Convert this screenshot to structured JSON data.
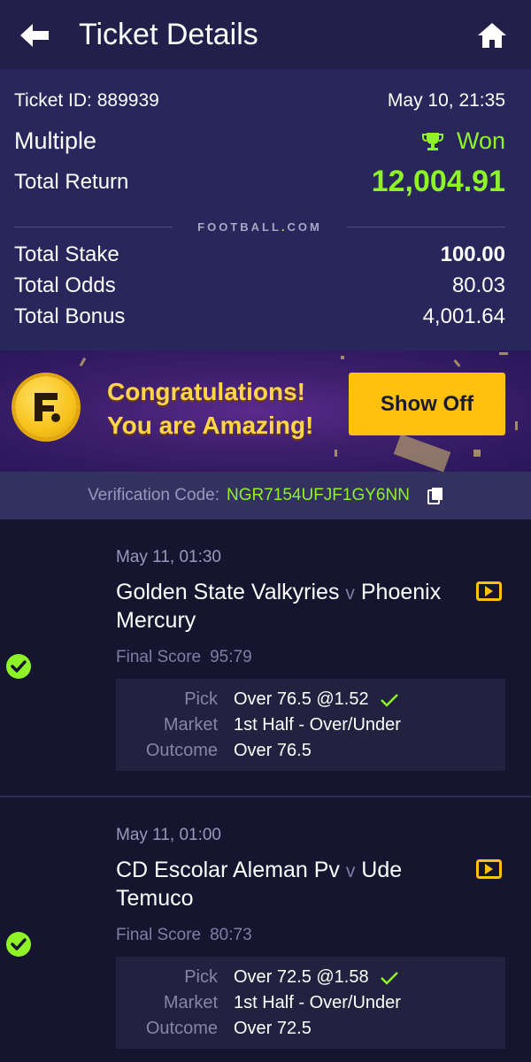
{
  "header": {
    "title": "Ticket Details",
    "back_icon": "arrow-left-icon",
    "home_icon": "home-icon"
  },
  "ticket": {
    "id_text": "Ticket ID: 889939",
    "datetime": "May 10, 21:35",
    "type": "Multiple",
    "status": "Won",
    "total_return_label": "Total Return",
    "total_return": "12,004.91",
    "brand": "FOOTBALL.COM",
    "stake_label": "Total Stake",
    "stake": "100.00",
    "odds_label": "Total Odds",
    "odds": "80.03",
    "bonus_label": "Total Bonus",
    "bonus": "4,001.64"
  },
  "banner": {
    "line1": "Congratulations!",
    "line2": "You are Amazing!",
    "button": "Show Off"
  },
  "verification": {
    "label": "Verification Code:",
    "code": "NGR7154UFJF1GY6NN"
  },
  "bets": [
    {
      "date": "May 11, 01:30",
      "home": "Golden State Valkyries",
      "vs": "v",
      "away": "Phoenix Mercury",
      "final_label": "Final Score",
      "score": "95:79",
      "pick_label": "Pick",
      "pick": "Over 76.5 @1.52",
      "market_label": "Market",
      "market": "1st Half - Over/Under",
      "outcome_label": "Outcome",
      "outcome": "Over 76.5"
    },
    {
      "date": "May 11, 01:00",
      "home": "CD Escolar Aleman Pv",
      "vs": "v",
      "away": "Ude Temuco",
      "final_label": "Final Score",
      "score": "80:73",
      "pick_label": "Pick",
      "pick": "Over 72.5 @1.58",
      "market_label": "Market",
      "market": "1st Half - Over/Under",
      "outcome_label": "Outcome",
      "outcome": "Over 72.5"
    }
  ],
  "colors": {
    "accent_green": "#8ef427",
    "accent_yellow": "#fdc10e",
    "header_bg": "#22204a",
    "panel_bg": "#28265a"
  }
}
